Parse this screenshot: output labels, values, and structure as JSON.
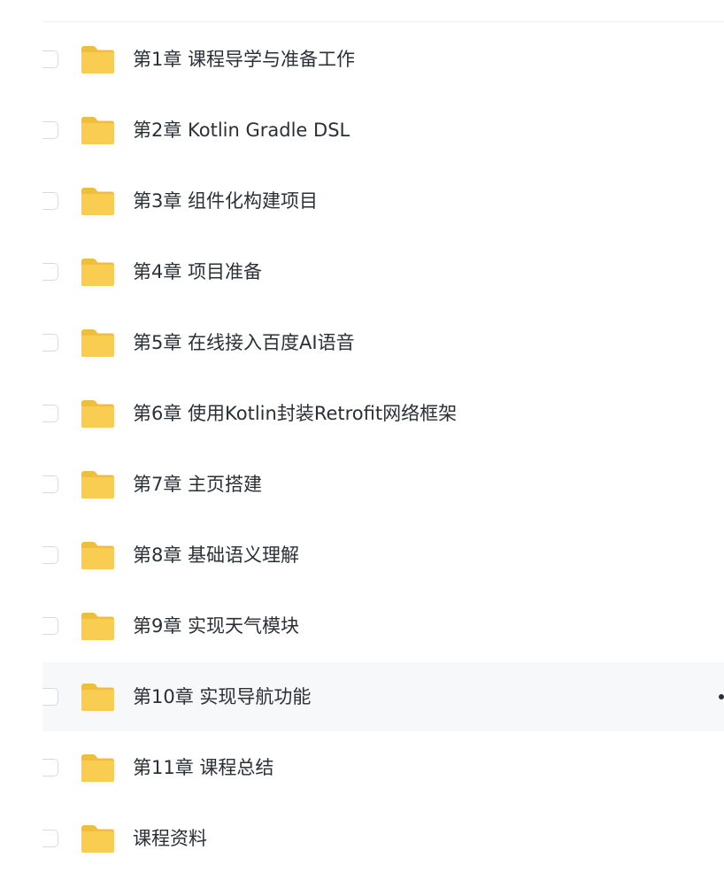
{
  "colors": {
    "folder": "#f8cd52",
    "folder_tab": "#f1bd3c",
    "text": "#2b2f36",
    "hover_row": "#f7f8fa",
    "checkbox_border": "#d7dbe2"
  },
  "folder_icon": "folder-icon",
  "folders": [
    {
      "name": "第1章 课程导学与准备工作"
    },
    {
      "name": "第2章 Kotlin Gradle DSL"
    },
    {
      "name": "第3章 组件化构建项目"
    },
    {
      "name": "第4章 项目准备"
    },
    {
      "name": "第5章 在线接入百度AI语音"
    },
    {
      "name": "第6章 使用Kotlin封装Retrofit网络框架"
    },
    {
      "name": "第7章 主页搭建"
    },
    {
      "name": "第8章 基础语义理解"
    },
    {
      "name": "第9章 实现天气模块"
    },
    {
      "name": "第10章 实现导航功能"
    },
    {
      "name": "第11章 课程总结"
    },
    {
      "name": "课程资料"
    }
  ],
  "hovered_index": 9
}
